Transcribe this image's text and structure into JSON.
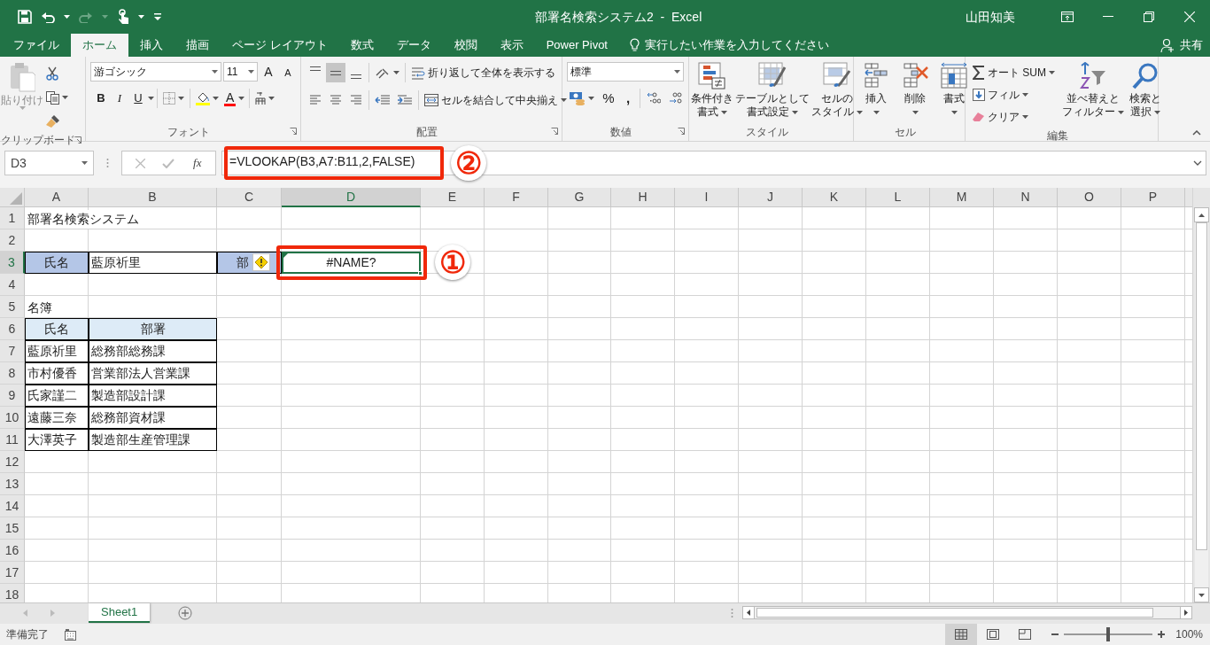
{
  "title_bar": {
    "title": "部署名検索システム2  -  Excel",
    "user": "山田知美"
  },
  "tabs": [
    {
      "label": "ファイル",
      "selected": false
    },
    {
      "label": "ホーム",
      "selected": true
    },
    {
      "label": "挿入",
      "selected": false
    },
    {
      "label": "描画",
      "selected": false
    },
    {
      "label": "ページ レイアウト",
      "selected": false
    },
    {
      "label": "数式",
      "selected": false
    },
    {
      "label": "データ",
      "selected": false
    },
    {
      "label": "校閲",
      "selected": false
    },
    {
      "label": "表示",
      "selected": false
    },
    {
      "label": "Power Pivot",
      "selected": false
    }
  ],
  "tell_me": "実行したい作業を入力してください",
  "share": "共有",
  "ribbon": {
    "clipboard": {
      "label": "クリップボード",
      "paste": {
        "label": "貼り付け",
        "disabled": true
      }
    },
    "font": {
      "label": "フォント",
      "font_name": "游ゴシック",
      "font_size": "11",
      "grow_font": "A",
      "shrink_font": "A",
      "bold": "B",
      "italic": "I",
      "underline": "U",
      "font_color": "A"
    },
    "alignment": {
      "label": "配置",
      "vertical": [
        {
          "selected": false
        },
        {
          "selected": true
        },
        {
          "selected": false
        }
      ],
      "wrap": "折り返して全体を表示する",
      "merge": "セルを結合して中央揃え"
    },
    "number": {
      "label": "数値",
      "format": "標準",
      "percent": "%",
      "comma": ","
    },
    "styles": {
      "label": "スタイル",
      "buttons": [
        {
          "lines": [
            "条件付き",
            "書式"
          ]
        },
        {
          "lines": [
            "テーブルとして",
            "書式設定"
          ]
        },
        {
          "lines": [
            "セルの",
            "スタイル"
          ]
        }
      ]
    },
    "cells": {
      "label": "セル",
      "buttons": [
        "挿入",
        "削除",
        "書式"
      ]
    },
    "editing": {
      "label": "編集",
      "autosum": "オート SUM",
      "fill": "フィル",
      "clear": "クリア",
      "sort": [
        "並べ替えと",
        "フィルター"
      ],
      "find": [
        "検索と",
        "選択"
      ]
    }
  },
  "formula_bar": {
    "name_box": "D3",
    "function_button": "fx",
    "formula": "=VLOOKAP(B3,A7:B11,2,FALSE)"
  },
  "columns": [
    {
      "label": "A",
      "selected": false
    },
    {
      "label": "B",
      "selected": false
    },
    {
      "label": "C",
      "selected": false
    },
    {
      "label": "D",
      "selected": true
    },
    {
      "label": "E",
      "selected": false
    },
    {
      "label": "F",
      "selected": false
    },
    {
      "label": "G",
      "selected": false
    },
    {
      "label": "H",
      "selected": false
    },
    {
      "label": "I",
      "selected": false
    },
    {
      "label": "J",
      "selected": false
    },
    {
      "label": "K",
      "selected": false
    },
    {
      "label": "L",
      "selected": false
    },
    {
      "label": "M",
      "selected": false
    },
    {
      "label": "N",
      "selected": false
    },
    {
      "label": "O",
      "selected": false
    },
    {
      "label": "P",
      "selected": false
    }
  ],
  "rows": [
    {
      "header": "1",
      "selected": false,
      "cells": [
        {
          "kind": "plain",
          "text": "部署名検索システム"
        }
      ]
    },
    {
      "header": "2",
      "selected": false
    },
    {
      "header": "3",
      "selected": true,
      "cells": [
        {
          "kind": "label",
          "text": "氏名"
        },
        {
          "kind": "boxed",
          "text": "藍原祈里"
        },
        {
          "kind": "label_flagged",
          "text": "部"
        },
        {
          "kind": "active",
          "text": "#NAME?"
        }
      ]
    },
    {
      "header": "4",
      "selected": false
    },
    {
      "header": "5",
      "selected": false,
      "cells": [
        {
          "kind": "plain",
          "text": "名簿"
        }
      ]
    },
    {
      "header": "6",
      "selected": false,
      "cells": [
        {
          "kind": "table_head",
          "text": "氏名"
        },
        {
          "kind": "table_head",
          "text": "部署"
        }
      ]
    },
    {
      "header": "7",
      "selected": false,
      "cells": [
        {
          "kind": "boxed",
          "text": "藍原祈里"
        },
        {
          "kind": "boxed",
          "text": "総務部総務課"
        }
      ]
    },
    {
      "header": "8",
      "selected": false,
      "cells": [
        {
          "kind": "boxed",
          "text": "市村優香"
        },
        {
          "kind": "boxed",
          "text": "営業部法人営業課"
        }
      ]
    },
    {
      "header": "9",
      "selected": false,
      "cells": [
        {
          "kind": "boxed",
          "text": "氏家謹二"
        },
        {
          "kind": "boxed",
          "text": "製造部設計課"
        }
      ]
    },
    {
      "header": "10",
      "selected": false,
      "cells": [
        {
          "kind": "boxed",
          "text": "遠藤三奈"
        },
        {
          "kind": "boxed",
          "text": "総務部資材課"
        }
      ]
    },
    {
      "header": "11",
      "selected": false,
      "cells": [
        {
          "kind": "boxed",
          "text": "大澤英子"
        },
        {
          "kind": "boxed",
          "text": "製造部生産管理課"
        }
      ]
    },
    {
      "header": "12",
      "selected": false
    },
    {
      "header": "13",
      "selected": false
    },
    {
      "header": "14",
      "selected": false
    },
    {
      "header": "15",
      "selected": false
    },
    {
      "header": "16",
      "selected": false
    },
    {
      "header": "17",
      "selected": false
    },
    {
      "header": "18",
      "selected": false
    }
  ],
  "callouts": [
    {
      "text": "①"
    },
    {
      "text": "②"
    }
  ],
  "sheet_tabs": [
    {
      "label": "Sheet1",
      "selected": true
    }
  ],
  "status_bar": {
    "status": "準備完了",
    "zoom": "100%",
    "zoom_level": {
      "level": 0.5
    }
  }
}
